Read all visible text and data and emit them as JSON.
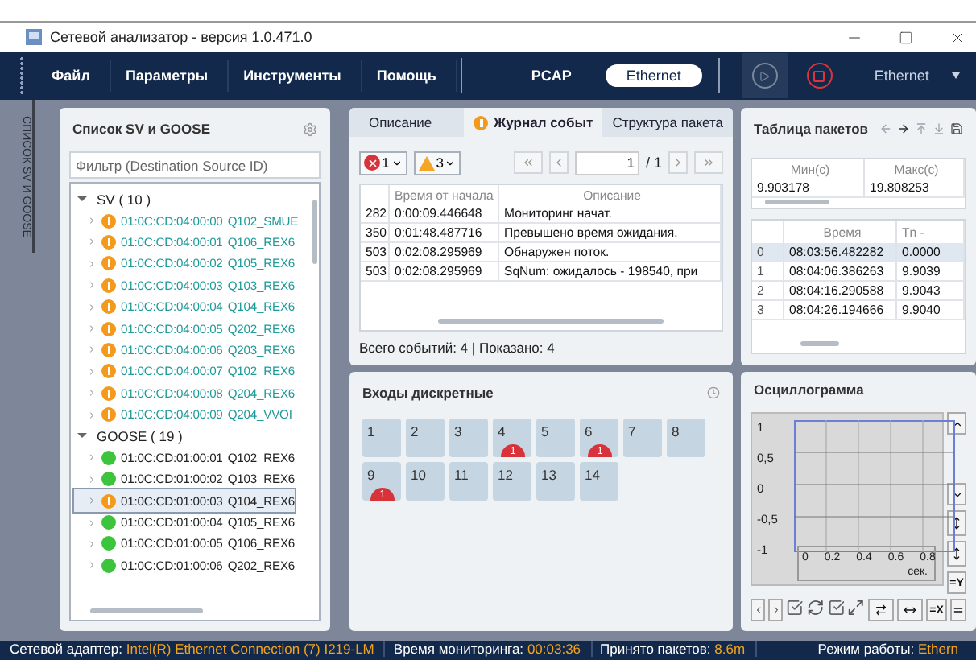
{
  "window": {
    "title": "Сетевой анализатор - версия 1.0.471.0"
  },
  "menu": [
    "Файл",
    "Параметры",
    "Инструменты",
    "Помощь"
  ],
  "source_modes": [
    {
      "label": "PCAP",
      "selected": false
    },
    {
      "label": "Ethernet",
      "selected": true
    }
  ],
  "capture": {
    "play_disabled": true,
    "stop_disabled": false,
    "interface": "Ethernet"
  },
  "side_tab": {
    "label": "СПИСОК SV И GOOSE"
  },
  "stream_list": {
    "title": "Список SV и GOOSE",
    "filter_placeholder": "Фильтр (Destination Source ID)",
    "groups": [
      {
        "label": "SV ( 10 )",
        "expanded": true,
        "kind": "sv",
        "children": [
          {
            "mac": "01:0C:CD:04:00:00",
            "name": "Q102_SMUE",
            "kind": "warning",
            "selected": false
          },
          {
            "mac": "01:0C:CD:04:00:01",
            "name": "Q106_REX6",
            "kind": "warning",
            "selected": false
          },
          {
            "mac": "01:0C:CD:04:00:02",
            "name": "Q105_REX6",
            "kind": "warning",
            "selected": false
          },
          {
            "mac": "01:0C:CD:04:00:03",
            "name": "Q103_REX6",
            "kind": "warning",
            "selected": false
          },
          {
            "mac": "01:0C:CD:04:00:04",
            "name": "Q104_REX6",
            "kind": "warning",
            "selected": false
          },
          {
            "mac": "01:0C:CD:04:00:05",
            "name": "Q202_REX6",
            "kind": "warning",
            "selected": false
          },
          {
            "mac": "01:0C:CD:04:00:06",
            "name": "Q203_REX6",
            "kind": "warning",
            "selected": false
          },
          {
            "mac": "01:0C:CD:04:00:07",
            "name": "Q102_REX6",
            "kind": "warning",
            "selected": false
          },
          {
            "mac": "01:0C:CD:04:00:08",
            "name": "Q204_REX6",
            "kind": "warning",
            "selected": false
          },
          {
            "mac": "01:0C:CD:04:00:09",
            "name": "Q204_VVOI",
            "kind": "warning",
            "selected": false
          }
        ]
      },
      {
        "label": "GOOSE ( 19 )",
        "expanded": true,
        "kind": "goose",
        "children": [
          {
            "mac": "01:0C:CD:01:00:01",
            "name": "Q102_REX6",
            "kind": "ok",
            "selected": false
          },
          {
            "mac": "01:0C:CD:01:00:02",
            "name": "Q103_REX6",
            "kind": "ok",
            "selected": false
          },
          {
            "mac": "01:0C:CD:01:00:03",
            "name": "Q104_REX6",
            "kind": "warning",
            "selected": true
          },
          {
            "mac": "01:0C:CD:01:00:04",
            "name": "Q105_REX6",
            "kind": "ok",
            "selected": false
          },
          {
            "mac": "01:0C:CD:01:00:05",
            "name": "Q106_REX6",
            "kind": "ok",
            "selected": false
          },
          {
            "mac": "01:0C:CD:01:00:06",
            "name": "Q202_REX6",
            "kind": "ok",
            "selected": false
          }
        ]
      }
    ]
  },
  "info_tabs": [
    {
      "label": "Описание",
      "selected": false,
      "warning": false
    },
    {
      "label": "Журнал событ",
      "selected": true,
      "warning": true
    },
    {
      "label": "Структура пакета",
      "selected": false,
      "warning": false
    }
  ],
  "event_log": {
    "errors": "1",
    "warnings": "3",
    "page": "1",
    "pages": "/ 1",
    "columns": [
      "",
      "Время от начала",
      "Описание"
    ],
    "rows": [
      [
        "282",
        "0:00:09.446648",
        "Мониторинг начат."
      ],
      [
        "350",
        "0:01:48.487716",
        "Превышено время ожидания."
      ],
      [
        "503",
        "0:02:08.295969",
        "Обнаружен поток."
      ],
      [
        "503",
        "0:02:08.295969",
        "SqNum: ожидалось - 198540, при"
      ]
    ],
    "summary": "Всего событий: 4 | Показано: 4"
  },
  "discrete_inputs": {
    "title": "Входы дискретные",
    "items": [
      {
        "label": "1"
      },
      {
        "label": "2"
      },
      {
        "label": "3"
      },
      {
        "label": "4",
        "alarm": "1"
      },
      {
        "label": "5"
      },
      {
        "label": "6",
        "alarm": "1"
      },
      {
        "label": "7"
      },
      {
        "label": "8"
      },
      {
        "label": "9",
        "alarm": "1"
      },
      {
        "label": "10"
      },
      {
        "label": "11"
      },
      {
        "label": "12"
      },
      {
        "label": "13"
      },
      {
        "label": "14"
      }
    ]
  },
  "packet_table": {
    "title": "Таблица пакетов",
    "range_columns": [
      "Мин(с)",
      "Макс(с)"
    ],
    "range_values": [
      "9.903178",
      "19.808253"
    ],
    "columns": [
      "Время",
      "Тn -"
    ],
    "rows": [
      {
        "index": "0",
        "time": "08:03:56.482282",
        "delta": "0.0000",
        "selected": true
      },
      {
        "index": "1",
        "time": "08:04:06.386263",
        "delta": "9.9039",
        "selected": false
      },
      {
        "index": "2",
        "time": "08:04:16.290588",
        "delta": "9.9043",
        "selected": false
      },
      {
        "index": "3",
        "time": "08:04:26.194666",
        "delta": "9.9040",
        "selected": false
      }
    ]
  },
  "oscillogram": {
    "title": "Осциллограмма",
    "yticks": [
      "1",
      "0,5",
      "0",
      "-0,5",
      "-1"
    ],
    "xticks": [
      "0",
      "0.2",
      "0.4",
      "0.6",
      "0.8"
    ],
    "x_unit": "сек.",
    "fit_y": "=Y",
    "fit_x": "=X"
  },
  "status_bar": [
    {
      "label": "Сетевой адаптер:",
      "value": "Intel(R) Ethernet Connection (7) I219-LM"
    },
    {
      "label": "Время мониторинга:",
      "value": "00:03:36"
    },
    {
      "label": "Принято пакетов:",
      "value": "8.6m"
    },
    {
      "label": "Режим работы:",
      "value": "Ethern"
    }
  ]
}
